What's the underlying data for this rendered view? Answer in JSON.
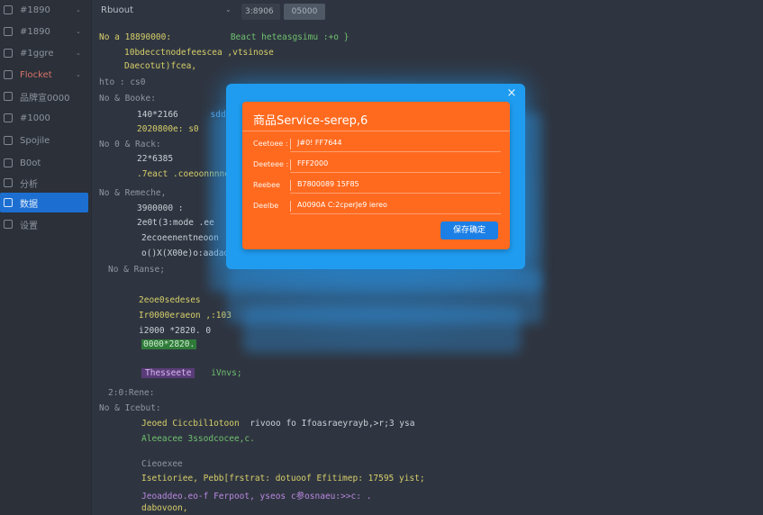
{
  "sidebar": {
    "items": [
      {
        "label": "#1890",
        "icon": "grid-icon",
        "chev": "⌄"
      },
      {
        "label": "#1890",
        "icon": "grid-icon",
        "chev": "⌄"
      },
      {
        "label": "#1ggre",
        "icon": "grid-icon",
        "chev": "⌄"
      },
      {
        "label": "Flocket",
        "icon": "cart-icon",
        "chev": "⌄"
      },
      {
        "label": "品牌宣0000",
        "icon": "table-icon",
        "chev": ""
      },
      {
        "label": "#1000",
        "icon": "table-icon",
        "chev": ""
      },
      {
        "label": "Spojile",
        "icon": "monitor-icon",
        "chev": ""
      },
      {
        "label": "B0ot",
        "icon": "terminal-icon",
        "chev": ""
      },
      {
        "label": "分析",
        "icon": "chart-icon",
        "chev": ""
      },
      {
        "label": "数据",
        "icon": "list-icon",
        "chev": ""
      },
      {
        "label": "设置",
        "icon": "settings-icon",
        "chev": ""
      }
    ]
  },
  "toolbar": {
    "title": "Rbuout",
    "chev": "⌄",
    "field_value": "3:8906",
    "button_label": "05000"
  },
  "code": {
    "lines": [
      {
        "t": "No  a  18890000:",
        "t2": "Beact  heteasgsimu :+o }"
      },
      {
        "t": "10bdecctnodefeescea  ,vtsinose",
        "t2": ""
      },
      {
        "t": "Daecotut)fcea,",
        "t2": ""
      },
      {
        "t": "hto : cs0",
        "t2": ""
      },
      {
        "t": "No  &    Booke:",
        "t2": ""
      },
      {
        "t": "140*2166",
        "t2": "sdds"
      },
      {
        "t": "2020800e: s0",
        "t2": ""
      },
      {
        "t": "No  0  &   Rack:",
        "t2": ""
      },
      {
        "t": "22*6385",
        "t2": ""
      },
      {
        "t": ".7eact .coeoonnnneonrer",
        "t2": ""
      },
      {
        "t": "No  &   Remeche,",
        "t2": ""
      },
      {
        "t": "3900000 :",
        "t2": ""
      },
      {
        "t": "2e0t(3:mode  .ee",
        "t2": ""
      },
      {
        "t": "2ecoeenentneoon",
        "t2": ""
      },
      {
        "t": "o()X(X00e)o:aadad",
        "t2": ""
      },
      {
        "t": "No  &   Ranse;",
        "t2": ""
      },
      {
        "t": "2eoe0sedeses",
        "t2": ""
      },
      {
        "t": "Ir0000eraeon ,:103",
        "t2": ""
      },
      {
        "t": "i2000  *2820.  0",
        "t2": ""
      },
      {
        "t": "0000*2820.",
        "t2": ""
      },
      {
        "t": "Thesseete",
        "t2": "iVnvs;"
      },
      {
        "t": "2:0:Rene:",
        "t2": ""
      },
      {
        "t": "No  &   Icebut:",
        "t2": ""
      },
      {
        "t": "Jeoed  Ciccbil1otoon",
        "t2": "rivooo  fo  Ifoasraeyrayb,>r;3  ysa"
      },
      {
        "t": "Aleeacee 3ssodcocee,c.",
        "t2": ""
      },
      {
        "t": "Cieoexee",
        "t2": ""
      },
      {
        "t": "Isetioriee,  Pebb[frstrat:  dotuoof Efitimep:  17595  yist;",
        "t2": ""
      },
      {
        "t": "Jeoaddeo.eo-f  Ferpoot,  yseos  c参osnaeu:>>c:  .",
        "t2": ""
      },
      {
        "t": "dabovoon,",
        "t2": ""
      }
    ]
  },
  "dialog": {
    "close_glyph": "×",
    "title": "商品Service-serep,6",
    "fields": [
      {
        "key": "Ceetoee :",
        "value": "J#0! FF7644"
      },
      {
        "key": "Deeteee  :",
        "value": "FFF2000"
      },
      {
        "key": "Reebee",
        "value": "B7800089 15F85"
      },
      {
        "key": "Deelbe",
        "value": "A0090A C:2cperJe9 iereo"
      }
    ],
    "ok_label": "保存确定"
  },
  "colors": {
    "accent": "#1c6fd1",
    "dialog_frame": "#1f9cf0",
    "dialog_body": "#ff6a1f",
    "background": "#2f3540"
  }
}
